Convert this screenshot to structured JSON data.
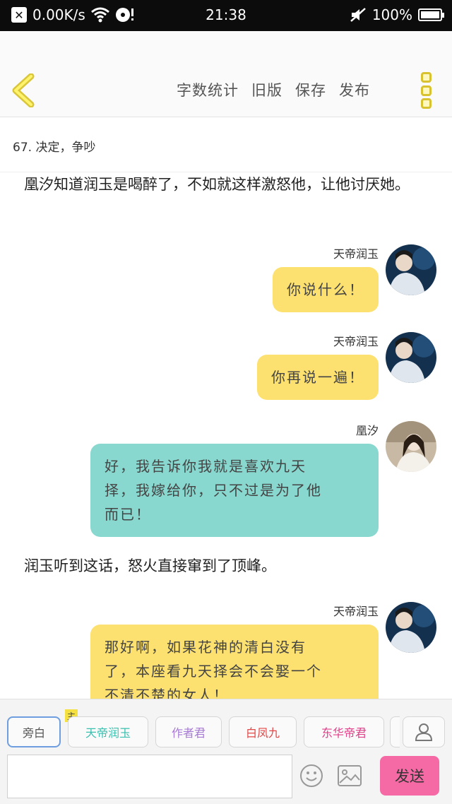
{
  "status_bar": {
    "net_speed": "0.00K/s",
    "time": "21:38",
    "battery": "100%"
  },
  "toolbar": {
    "actions": [
      "字数统计",
      "旧版",
      "保存",
      "发布"
    ]
  },
  "chapter": {
    "title": "67. 决定，争吵"
  },
  "story": {
    "narration_1": "凰汐知道润玉是喝醉了，不如就这样激怒他，让他讨厌她。",
    "msg1": {
      "speaker": "天帝润玉",
      "lines": [
        "你说什么！"
      ]
    },
    "msg2": {
      "speaker": "天帝润玉",
      "lines": [
        "你再说一遍！"
      ]
    },
    "msg3": {
      "speaker": "凰汐",
      "lines": [
        "好，我告诉你我就是喜欢九天",
        "择，我嫁给你，只不过是为了他",
        "而已！"
      ]
    },
    "narration_2": "润玉听到这话，怒火直接窜到了顶峰。",
    "msg4": {
      "speaker": "天帝润玉",
      "lines": [
        "那好啊，如果花神的清白没有",
        "了，本座看九天择会不会娶一个",
        "不清不楚的女人！"
      ]
    }
  },
  "bottom": {
    "roles": [
      {
        "label": "旁白",
        "color": "#666666"
      },
      {
        "label": "天帝润玉",
        "color": "#3bbfae"
      },
      {
        "label": "作者君",
        "color": "#a77ad6"
      },
      {
        "label": "白凤九",
        "color": "#e24848"
      },
      {
        "label": "东华帝君",
        "color": "#e0408a"
      }
    ],
    "host_tag": "主",
    "send_label": "发送",
    "input_placeholder": ""
  }
}
